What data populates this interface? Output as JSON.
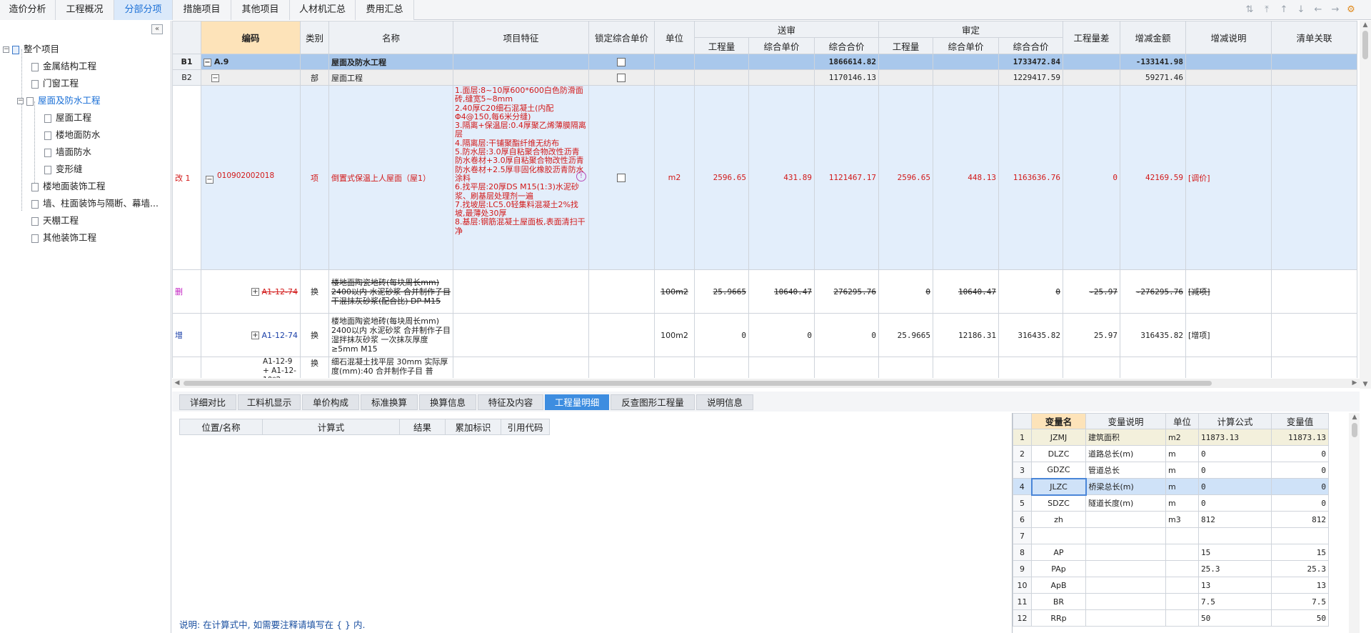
{
  "top_tabs": [
    "造价分析",
    "工程概况",
    "分部分项",
    "措施项目",
    "其他项目",
    "人材机汇总",
    "费用汇总"
  ],
  "active_top_tab": "分部分项",
  "tree": {
    "root": "整个项目",
    "items": [
      {
        "label": "金属结构工程",
        "level": 1,
        "box": false
      },
      {
        "label": "门窗工程",
        "level": 1,
        "box": false
      },
      {
        "label": "屋面及防水工程",
        "level": 1,
        "box": true,
        "active": true
      },
      {
        "label": "屋面工程",
        "level": 2,
        "box": false
      },
      {
        "label": "楼地面防水",
        "level": 2,
        "box": false
      },
      {
        "label": "墙面防水",
        "level": 2,
        "box": false
      },
      {
        "label": "变形缝",
        "level": 2,
        "box": false
      },
      {
        "label": "楼地面装饰工程",
        "level": 1,
        "box": false
      },
      {
        "label": "墙、柱面装饰与隔断、幕墙...",
        "level": 1,
        "box": false
      },
      {
        "label": "天棚工程",
        "level": 1,
        "box": false
      },
      {
        "label": "其他装饰工程",
        "level": 1,
        "box": false
      }
    ]
  },
  "grid": {
    "headers": {
      "code": "编码",
      "category": "类别",
      "name": "名称",
      "feature": "项目特征",
      "lock": "锁定综合单价",
      "unit": "单位",
      "submit": "送审",
      "approve": "审定",
      "qty": "工程量",
      "unit_price": "综合单价",
      "total": "综合合价",
      "qty_diff": "工程量差",
      "delta": "增减金额",
      "delta_note": "增减说明",
      "list_rel": "清单关联"
    },
    "rows": {
      "b1": {
        "hdr": "B1",
        "code": "A.9",
        "name": "屋面及防水工程",
        "s_total": "1866614.82",
        "a_total": "1733472.84",
        "delta": "-133141.98"
      },
      "b2": {
        "hdr": "B2",
        "cat": "部",
        "name": "屋面工程",
        "s_total": "1170146.13",
        "a_total": "1229417.59",
        "delta": "59271.46"
      },
      "r1": {
        "hdr": "改",
        "idx": "1",
        "code": "010902002018",
        "cat": "项",
        "name": "倒置式保温上人屋面（屋1）",
        "feature": "1.面层:8~10厚600*600白色防滑面砖,缝宽5~8mm\n2.40厚C20细石混凝土(内配Φ4@150,每6米分缝)\n3.隔离+保温层:0.4厚聚乙烯薄膜隔离层\n4.隔离层:干铺聚酯纤维无纺布\n5.防水层:3.0厚自粘聚合物改性沥青防水卷材+3.0厚自粘聚合物改性沥青防水卷材+2.5厚非固化橡胶沥青防水涂料\n6.找平层:20厚DS M15(1:3)水泥砂浆、刷基层处理剂一遍\n7.找坡层:LC5.0轻集料混凝土2%找坡,最薄处30厚\n8.基层:钢筋混凝土屋面板,表面清扫干净",
        "unit": "m2",
        "s_qty": "2596.65",
        "s_price": "431.89",
        "s_total": "1121467.17",
        "a_qty": "2596.65",
        "a_price": "448.13",
        "a_total": "1163636.76",
        "qty_diff": "0",
        "delta": "42169.59",
        "note": "[调价]"
      },
      "del": {
        "hdr": "删",
        "code": "A1-12-74",
        "cat": "换",
        "name": "楼地面陶瓷地砖(每块周长mm) 2400以内 水泥砂浆  合并制作子目 干混抹灰砂浆(配合比) DP M15",
        "unit": "100m2",
        "s_qty": "25.9665",
        "s_price": "10640.47",
        "s_total": "276295.76",
        "a_qty": "0",
        "a_price": "10640.47",
        "a_total": "0",
        "qty_diff": "-25.97",
        "delta": "-276295.76",
        "note": "[减项]"
      },
      "add": {
        "hdr": "增",
        "code": "A1-12-74",
        "cat": "换",
        "name": "楼地面陶瓷地砖(每块周长mm) 2400以内 水泥砂浆  合并制作子目 湿拌抹灰砂浆 一次抹灰厚度≥5mm M15",
        "unit": "100m2",
        "s_qty": "0",
        "s_price": "0",
        "s_total": "0",
        "a_qty": "25.9665",
        "a_price": "12186.31",
        "a_total": "316435.82",
        "qty_diff": "25.97",
        "delta": "316435.82",
        "note": "[增项]"
      },
      "next": {
        "code": "A1-12-9 + A1-12-10*2",
        "cat": "换",
        "name": "细石混凝土找平层 30mm  实际厚度(mm):40  合并制作子目 普"
      }
    }
  },
  "bottom_tabs": [
    "详细对比",
    "工料机显示",
    "单价构成",
    "标准换算",
    "换算信息",
    "特征及内容",
    "工程量明细",
    "反查图形工程量",
    "说明信息"
  ],
  "active_bottom_tab": "工程量明细",
  "detail": {
    "headers": [
      "位置/名称",
      "计算式",
      "结果",
      "累加标识",
      "引用代码"
    ],
    "note": "说明: 在计算式中, 如需要注释请填写在 { } 内."
  },
  "vars": {
    "headers": [
      "变量名",
      "变量说明",
      "单位",
      "计算公式",
      "变量值"
    ],
    "rows": [
      {
        "n": "1",
        "name": "JZMJ",
        "desc": "建筑面积",
        "unit": "m2",
        "formula": "11873.13",
        "value": "11873.13"
      },
      {
        "n": "2",
        "name": "DLZC",
        "desc": "道路总长(m)",
        "unit": "m",
        "formula": "0",
        "value": "0"
      },
      {
        "n": "3",
        "name": "GDZC",
        "desc": "管道总长",
        "unit": "m",
        "formula": "0",
        "value": "0"
      },
      {
        "n": "4",
        "name": "JLZC",
        "desc": "桥梁总长(m)",
        "unit": "m",
        "formula": "0",
        "value": "0"
      },
      {
        "n": "5",
        "name": "SDZC",
        "desc": "隧道长度(m)",
        "unit": "m",
        "formula": "0",
        "value": "0"
      },
      {
        "n": "6",
        "name": "zh",
        "desc": "",
        "unit": "m3",
        "formula": "812",
        "value": "812"
      },
      {
        "n": "7",
        "name": "",
        "desc": "",
        "unit": "",
        "formula": "",
        "value": ""
      },
      {
        "n": "8",
        "name": "AP",
        "desc": "",
        "unit": "",
        "formula": "15",
        "value": "15"
      },
      {
        "n": "9",
        "name": "PAp",
        "desc": "",
        "unit": "",
        "formula": "25.3",
        "value": "25.3"
      },
      {
        "n": "10",
        "name": "ApB",
        "desc": "",
        "unit": "",
        "formula": "13",
        "value": "13"
      },
      {
        "n": "11",
        "name": "BR",
        "desc": "",
        "unit": "",
        "formula": "7.5",
        "value": "7.5"
      },
      {
        "n": "12",
        "name": "RRp",
        "desc": "",
        "unit": "",
        "formula": "50",
        "value": "50"
      }
    ],
    "selected_row": "4"
  },
  "colors": {
    "accent": "#1a6fd6",
    "selected_row": "#a9c8ec",
    "changed_text": "#d21919",
    "active_tab": "#3d8de0"
  }
}
